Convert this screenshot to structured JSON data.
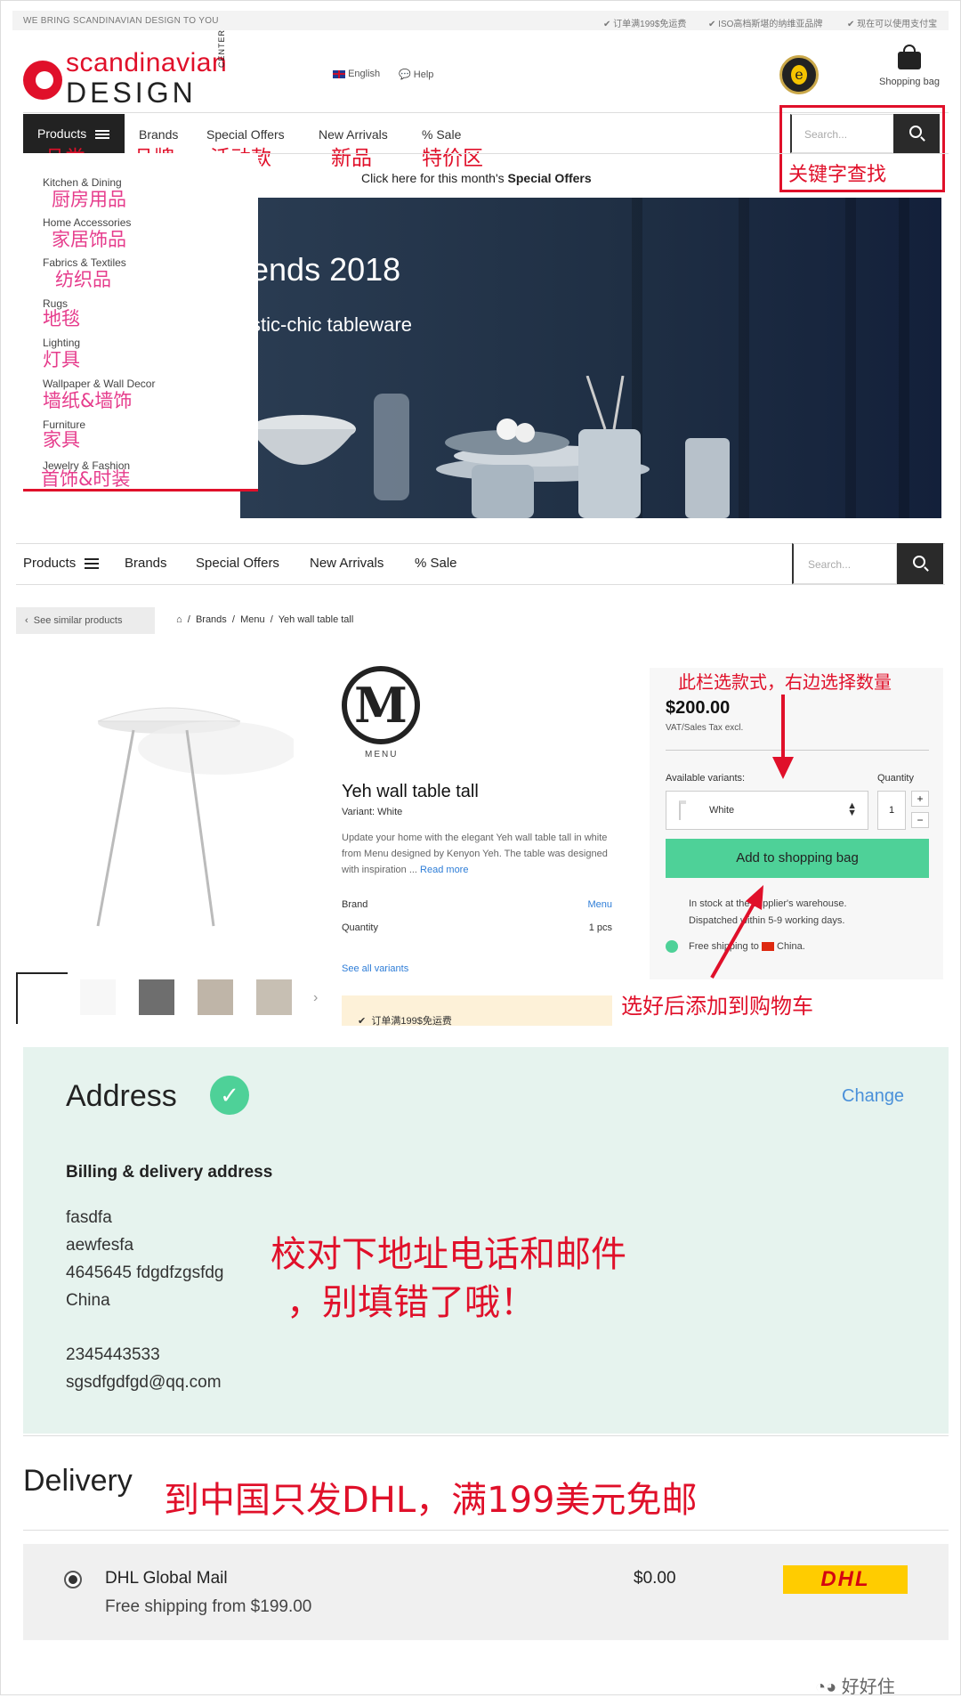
{
  "topbar": {
    "tagline": "WE BRING SCANDINAVIAN DESIGN TO YOU",
    "usps": [
      "订单满199$免运费",
      "ISO高档斯堪的纳维亚品牌",
      "现在可以使用支付宝"
    ]
  },
  "header": {
    "logo_top": "scandinavian",
    "logo_bottom": "DESIGN",
    "logo_side": "CENTER",
    "lang": "English",
    "help": "Help",
    "bag": "Shopping bag"
  },
  "nav": {
    "products": "Products",
    "brands": "Brands",
    "offers": "Special Offers",
    "new": "New Arrivals",
    "sale": "% Sale",
    "search_placeholder": "Search..."
  },
  "nav_cn": {
    "products": "品类",
    "brands": "品牌",
    "offers": "活动款",
    "new": "新品",
    "sale": "特价区",
    "search": "关键字查找"
  },
  "dropdown": [
    {
      "en": "Kitchen & Dining",
      "cn": "厨房用品"
    },
    {
      "en": "Home Accessories",
      "cn": "家居饰品"
    },
    {
      "en": "Fabrics & Textiles",
      "cn": "纺织品"
    },
    {
      "en": "Rugs",
      "cn": "地毯"
    },
    {
      "en": "Lighting",
      "cn": "灯具"
    },
    {
      "en": "Wallpaper & Wall Decor",
      "cn": "墙纸&墙饰"
    },
    {
      "en": "Furniture",
      "cn": "家具"
    },
    {
      "en": "Jewelry & Fashion",
      "cn": "首饰&时装"
    }
  ],
  "promo": {
    "prefix": "Click here for this month's ",
    "bold": "Special Offers"
  },
  "hero": {
    "title": "ends 2018",
    "subtitle": "stic-chic tableware"
  },
  "breadcrumb": {
    "back": "See similar products",
    "items": [
      "Brands",
      "Menu",
      "Yeh wall table tall"
    ]
  },
  "product": {
    "brand_logo": "M",
    "brand_logo_label": "MENU",
    "name": "Yeh wall table tall",
    "variant": "Variant: White",
    "desc": "Update your home with the elegant Yeh wall table tall in white from Menu designed by Kenyon Yeh. The table was designed with inspiration ... ",
    "read_more": "Read more",
    "specs": [
      {
        "k": "Brand",
        "v": "Menu"
      },
      {
        "k": "Quantity",
        "v": "1 pcs"
      }
    ],
    "see_all": "See all variants",
    "usp": "订单满199$免运费",
    "price": "$200.00",
    "tax": "VAT/Sales Tax excl.",
    "variants_label": "Available variants:",
    "variant_value": "White",
    "qty_label": "Quantity",
    "qty": "1",
    "add": "Add to shopping bag",
    "stock1": "In stock at the supplier's warehouse.",
    "stock2": "Dispatched within 5-9 working days.",
    "shipping": "Free shipping to ",
    "ship_country": "China."
  },
  "annot": {
    "variants": "此栏选款式，右边选择数量",
    "add": "选好后添加到购物车",
    "address": "校对下地址电话和邮件",
    "address2": "，别填错了哦！",
    "delivery": "到中国只发DHL，满199美元免邮"
  },
  "address": {
    "title": "Address",
    "change": "Change",
    "subtitle": "Billing & delivery address",
    "lines": [
      "fasdfa",
      "aewfesfa",
      "4645645 fdgdfzgsfdg",
      "China"
    ],
    "phone": "2345443533",
    "email": "sgsdfgdfgd@qq.com"
  },
  "delivery": {
    "title": "Delivery",
    "option": "DHL Global Mail",
    "note": "Free shipping from $199.00",
    "price": "$0.00",
    "carrier_logo": "DHL"
  },
  "watermark": "好好住",
  "colors": {
    "accent": "#e0102a",
    "green": "#4ed198",
    "mint": "#e6f3ee"
  }
}
